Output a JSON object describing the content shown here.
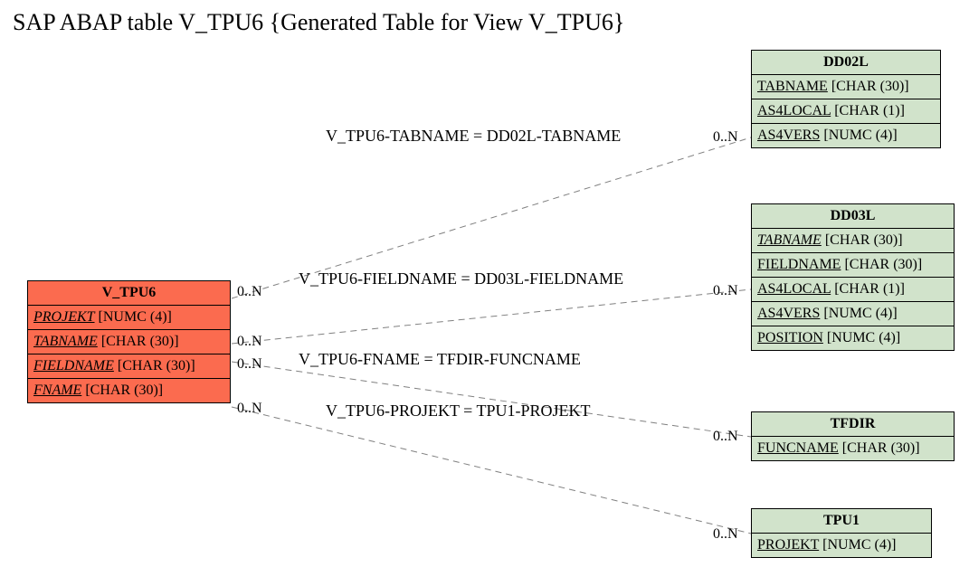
{
  "title": "SAP ABAP table V_TPU6 {Generated Table for View V_TPU6}",
  "entities": {
    "v_tpu6": {
      "name": "V_TPU6",
      "fields": [
        {
          "name": "PROJEKT",
          "type": "[NUMC (4)]",
          "italic": true
        },
        {
          "name": "TABNAME",
          "type": "[CHAR (30)]",
          "italic": true
        },
        {
          "name": "FIELDNAME",
          "type": "[CHAR (30)]",
          "italic": true
        },
        {
          "name": "FNAME",
          "type": "[CHAR (30)]",
          "italic": true
        }
      ]
    },
    "dd02l": {
      "name": "DD02L",
      "fields": [
        {
          "name": "TABNAME",
          "type": "[CHAR (30)]",
          "italic": false
        },
        {
          "name": "AS4LOCAL",
          "type": "[CHAR (1)]",
          "italic": false
        },
        {
          "name": "AS4VERS",
          "type": "[NUMC (4)]",
          "italic": false
        }
      ]
    },
    "dd03l": {
      "name": "DD03L",
      "fields": [
        {
          "name": "TABNAME",
          "type": "[CHAR (30)]",
          "italic": true
        },
        {
          "name": "FIELDNAME",
          "type": "[CHAR (30)]",
          "italic": false
        },
        {
          "name": "AS4LOCAL",
          "type": "[CHAR (1)]",
          "italic": false
        },
        {
          "name": "AS4VERS",
          "type": "[NUMC (4)]",
          "italic": false
        },
        {
          "name": "POSITION",
          "type": "[NUMC (4)]",
          "italic": false
        }
      ]
    },
    "tfdir": {
      "name": "TFDIR",
      "fields": [
        {
          "name": "FUNCNAME",
          "type": "[CHAR (30)]",
          "italic": false
        }
      ]
    },
    "tpu1": {
      "name": "TPU1",
      "fields": [
        {
          "name": "PROJEKT",
          "type": "[NUMC (4)]",
          "italic": false
        }
      ]
    }
  },
  "relations": {
    "r1": {
      "label": "V_TPU6-TABNAME = DD02L-TABNAME"
    },
    "r2": {
      "label": "V_TPU6-FIELDNAME = DD03L-FIELDNAME"
    },
    "r3": {
      "label": "V_TPU6-FNAME = TFDIR-FUNCNAME"
    },
    "r4": {
      "label": "V_TPU6-PROJEKT = TPU1-PROJEKT"
    }
  },
  "card": "0..N"
}
